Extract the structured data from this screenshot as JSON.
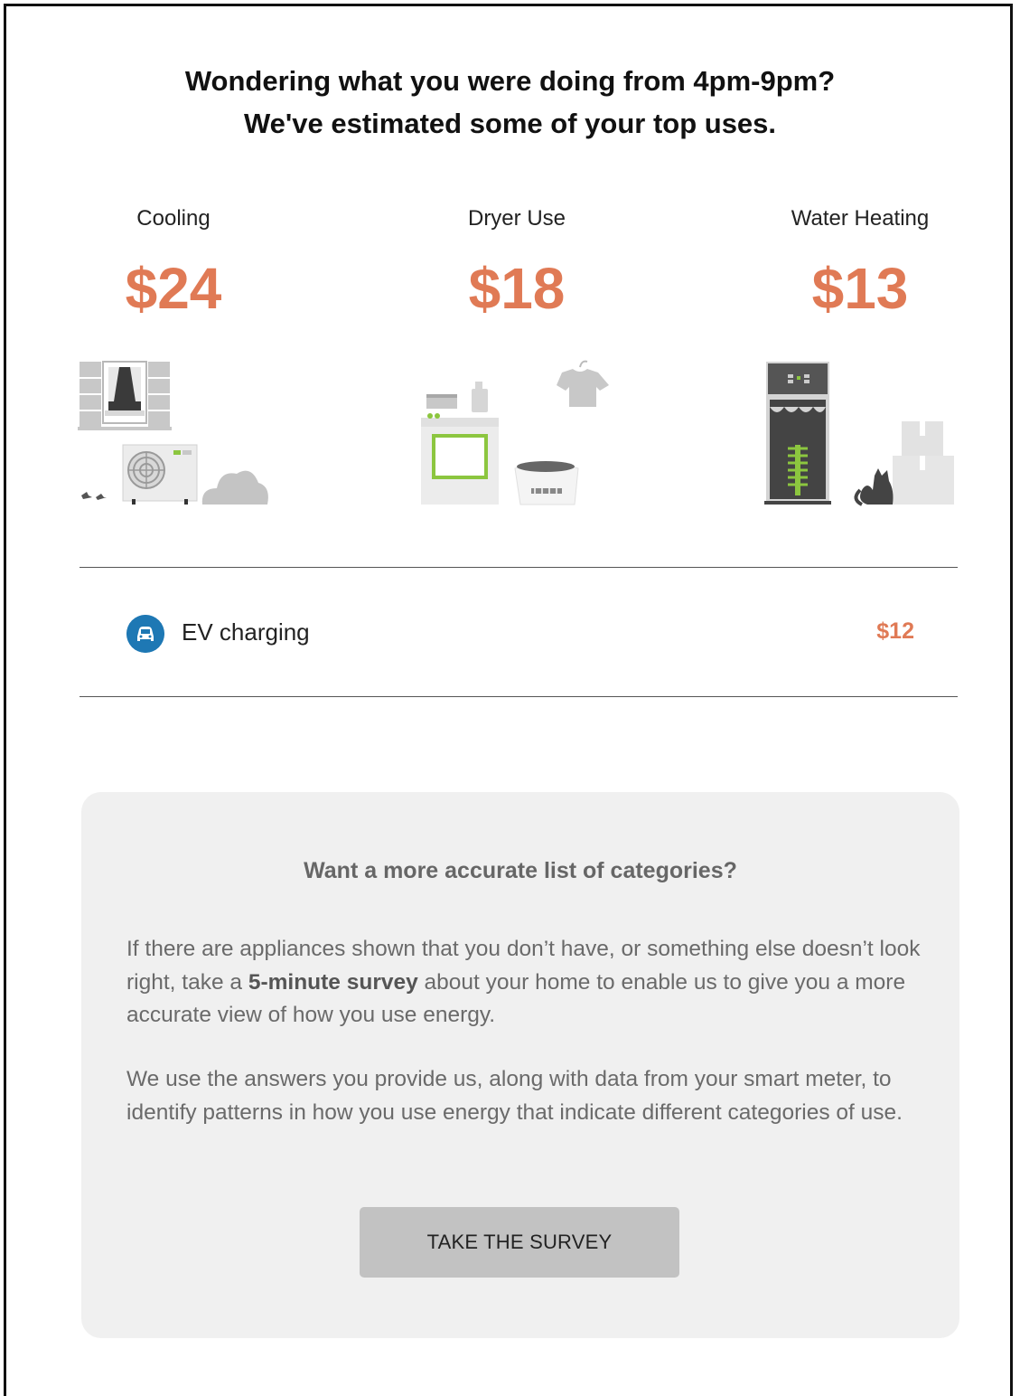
{
  "heading": {
    "line1": "Wondering what you were doing from 4pm-9pm?",
    "line2": "We've estimated some of your top uses."
  },
  "categories": [
    {
      "label": "Cooling",
      "amount": "$24",
      "icon": "cooling-scene-icon"
    },
    {
      "label": "Dryer Use",
      "amount": "$18",
      "icon": "laundry-scene-icon"
    },
    {
      "label": "Water Heating",
      "amount": "$13",
      "icon": "water-heater-scene-icon"
    }
  ],
  "ev": {
    "label": "EV charging",
    "amount": "$12",
    "icon": "car-icon"
  },
  "survey_panel": {
    "title": "Want a more accurate list of categories?",
    "p1_before": "If there are appliances shown that you don’t have, or something else doesn’t look right, take a ",
    "p1_bold": "5-minute survey",
    "p1_after": " about your home to enable us to give you a more accurate view of how you use energy.",
    "p2": "We use the answers you provide us, along with data from your smart meter, to identify patterns in how you use energy that indicate different categories of use.",
    "button_label": "TAKE THE SURVEY"
  },
  "colors": {
    "accent": "#e07a55",
    "ev_icon": "#1e78b4",
    "panel_bg": "#f0f0f0",
    "button_bg": "#c2c2c2",
    "illustration_green": "#8cc63f"
  }
}
